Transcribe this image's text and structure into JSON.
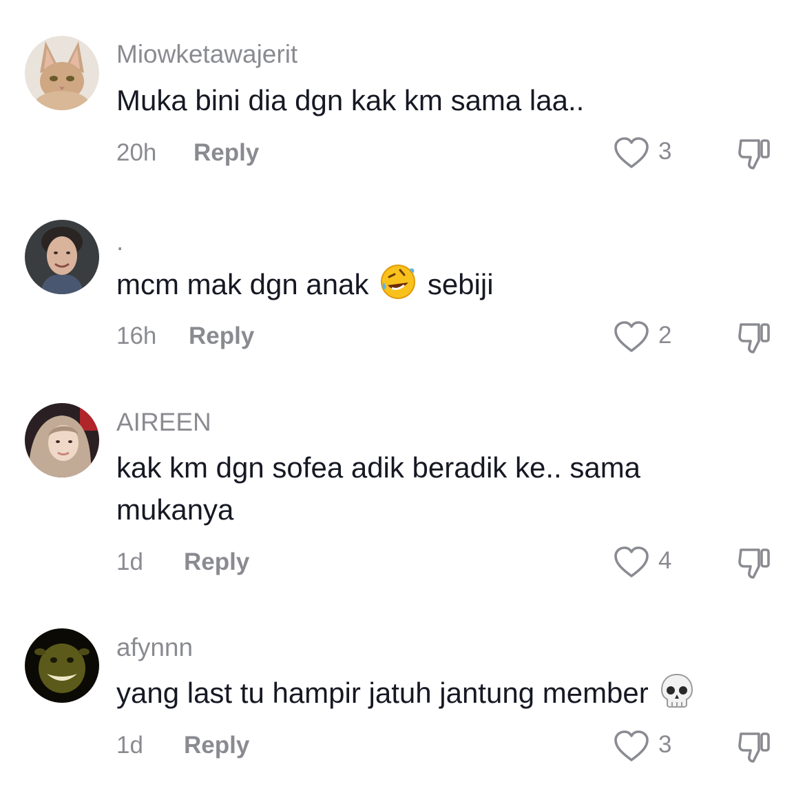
{
  "comments": [
    {
      "username": "Miowketawajerit",
      "text": "Muka bini dia dgn kak km sama laa..",
      "time": "20h",
      "reply_label": "Reply",
      "likes": "3",
      "avatar": "cat-avatar"
    },
    {
      "username": ".",
      "text_before": "mcm mak dgn anak",
      "emoji": "rolling-on-floor-laughing-emoji",
      "text_after": "sebiji",
      "time": "16h",
      "reply_label": "Reply",
      "likes": "2",
      "avatar": "man-avatar"
    },
    {
      "username": "AIREEN",
      "text": "kak km dgn sofea adik beradik ke.. sama mukanya",
      "time": "1d",
      "reply_label": "Reply",
      "likes": "4",
      "avatar": "hijab-woman-avatar"
    },
    {
      "username": "afynnn",
      "text": "yang last tu hampir jatuh jantung member",
      "emoji": "skull-emoji",
      "time": "1d",
      "reply_label": "Reply",
      "likes": "3",
      "avatar": "green-face-avatar"
    }
  ],
  "colors": {
    "text": "#161823",
    "secondary": "#8a8b91",
    "background": "#ffffff"
  }
}
